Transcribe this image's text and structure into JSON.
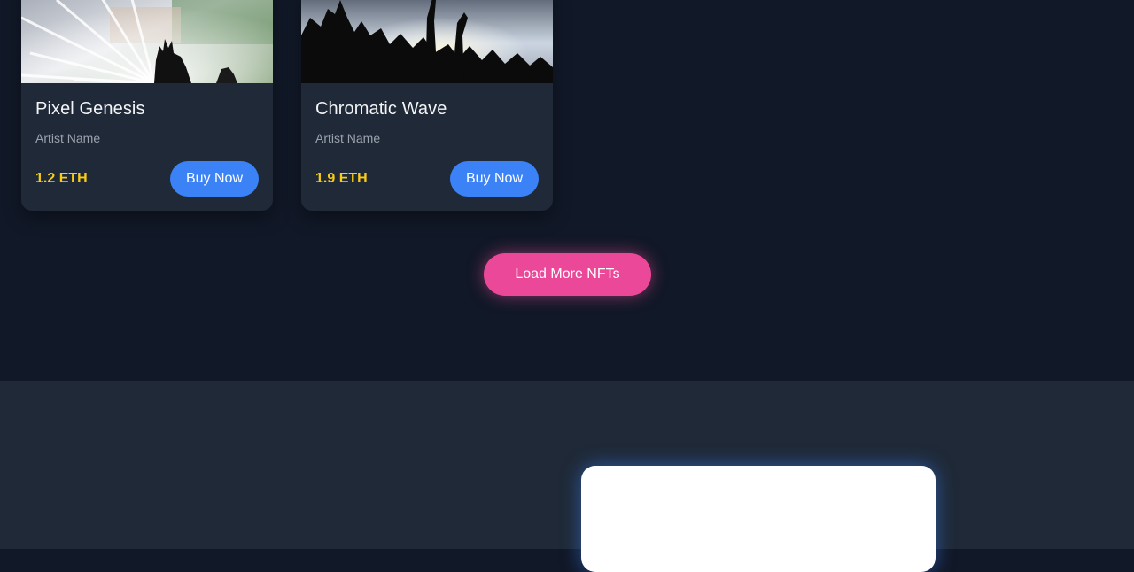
{
  "nft_cards": [
    {
      "title": "Pixel Genesis",
      "artist": "Artist Name",
      "price": "1.2 ETH",
      "buy_label": "Buy Now",
      "image_icon": "concert-light-rays-image"
    },
    {
      "title": "Chromatic Wave",
      "artist": "Artist Name",
      "price": "1.9 ETH",
      "buy_label": "Buy Now",
      "image_icon": "concert-crowd-image"
    }
  ],
  "load_more_label": "Load More NFTs",
  "colors": {
    "background": "#111827",
    "card": "#1f2937",
    "price": "#facc15",
    "buy_button": "#3b82f6",
    "load_more": "#ec4899",
    "lower_section": "#1f2937"
  }
}
